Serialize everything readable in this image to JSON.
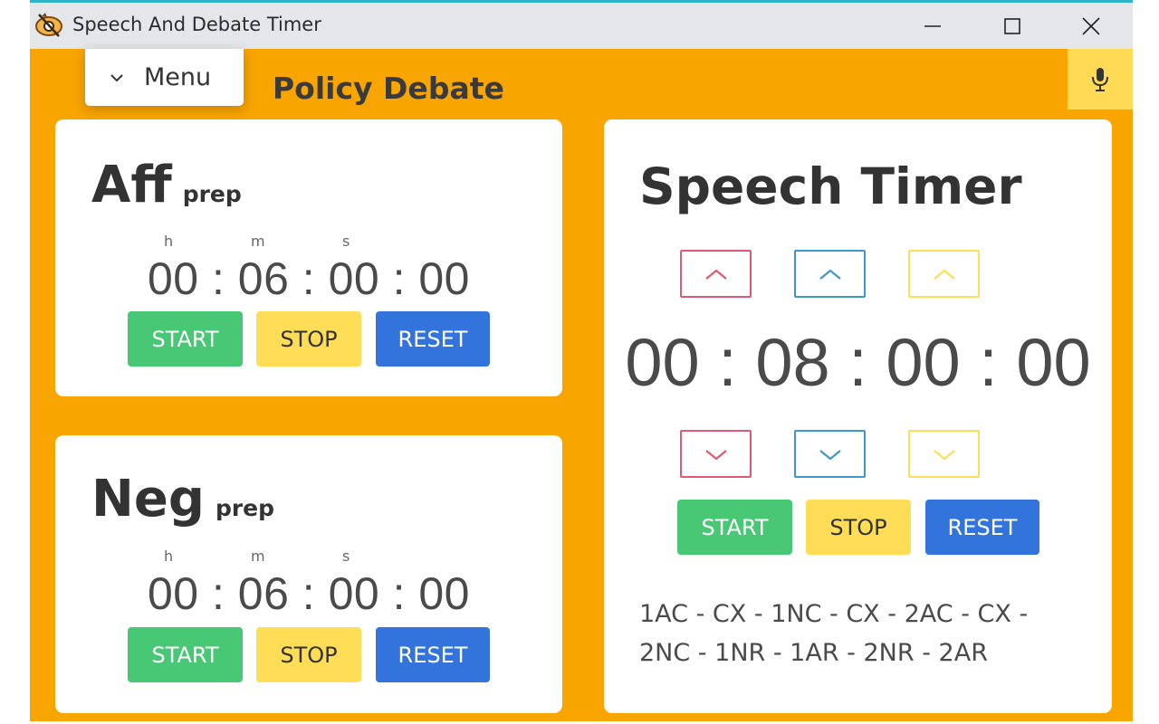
{
  "window": {
    "title": "Speech And Debate Timer",
    "icon": "app-logo-icon",
    "controls": [
      "minimize-icon",
      "maximize-icon",
      "close-icon"
    ]
  },
  "header": {
    "menu_label": "Menu",
    "menu_icon": "chevron-down-icon",
    "page_title": "Policy Debate",
    "mic_icon": "microphone-icon"
  },
  "aff": {
    "name": "Aff",
    "sub": "prep",
    "units": {
      "h": "h",
      "m": "m",
      "s": "s"
    },
    "time": "00 : 06 : 00 : 00",
    "start": "START",
    "stop": "STOP",
    "reset": "RESET"
  },
  "neg": {
    "name": "Neg",
    "sub": "prep",
    "units": {
      "h": "h",
      "m": "m",
      "s": "s"
    },
    "time": "00 : 06 : 00 : 00",
    "start": "START",
    "stop": "STOP",
    "reset": "RESET"
  },
  "speech": {
    "title": "Speech Timer",
    "time": "00 : 08 : 00 : 00",
    "start": "START",
    "stop": "STOP",
    "reset": "RESET",
    "order": "1AC - CX - 1NC - CX - 2AC - CX - 2NC - 1NR - 1AR - 2NR - 2AR",
    "arrow_colors": {
      "hours": "#e05873",
      "minutes": "#3e98c7",
      "seconds": "#ffdd57"
    }
  },
  "colors": {
    "background": "#f9a500",
    "start": "#48c774",
    "stop": "#ffdd57",
    "reset": "#3273dc"
  }
}
